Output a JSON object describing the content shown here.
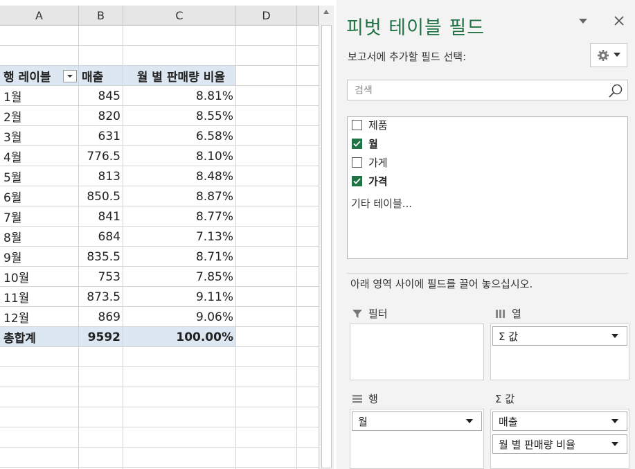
{
  "sheet": {
    "columns": [
      "A",
      "B",
      "C",
      "D"
    ],
    "header": {
      "row_labels": "행 레이블",
      "sales": "매출",
      "ratio": "월 별 판매량 비율"
    },
    "rows": [
      {
        "label": "1월",
        "sales": "845",
        "ratio": "8.81%"
      },
      {
        "label": "2월",
        "sales": "820",
        "ratio": "8.55%"
      },
      {
        "label": "3월",
        "sales": "631",
        "ratio": "6.58%"
      },
      {
        "label": "4월",
        "sales": "776.5",
        "ratio": "8.10%"
      },
      {
        "label": "5월",
        "sales": "813",
        "ratio": "8.48%"
      },
      {
        "label": "6월",
        "sales": "850.5",
        "ratio": "8.87%"
      },
      {
        "label": "7월",
        "sales": "841",
        "ratio": "8.77%"
      },
      {
        "label": "8월",
        "sales": "684",
        "ratio": "7.13%"
      },
      {
        "label": "9월",
        "sales": "835.5",
        "ratio": "8.71%"
      },
      {
        "label": "10월",
        "sales": "753",
        "ratio": "7.85%"
      },
      {
        "label": "11월",
        "sales": "873.5",
        "ratio": "9.11%"
      },
      {
        "label": "12월",
        "sales": "869",
        "ratio": "9.06%"
      }
    ],
    "total": {
      "label": "총합계",
      "sales": "9592",
      "ratio": "100.00%"
    }
  },
  "panel": {
    "title": "피벗 테이블 필드",
    "subtitle": "보고서에 추가할 필드 선택:",
    "search_placeholder": "검색",
    "fields": [
      {
        "label": "제품",
        "checked": false
      },
      {
        "label": "월",
        "checked": true
      },
      {
        "label": "가게",
        "checked": false
      },
      {
        "label": "가격",
        "checked": true
      }
    ],
    "more_tables": "기타 테이블...",
    "drag_hint": "아래 영역 사이에 필드를 끌어 놓으십시오.",
    "areas": {
      "filters": {
        "label": "필터",
        "items": []
      },
      "columns": {
        "label": "열",
        "items": [
          "Σ 값"
        ]
      },
      "rows": {
        "label": "행",
        "items": [
          "월"
        ]
      },
      "values": {
        "label": "Σ 값",
        "items": [
          "매출",
          "월 별 판매량 비율"
        ]
      }
    },
    "accent_color": "#217346",
    "header_band_color": "#dde7f2"
  }
}
